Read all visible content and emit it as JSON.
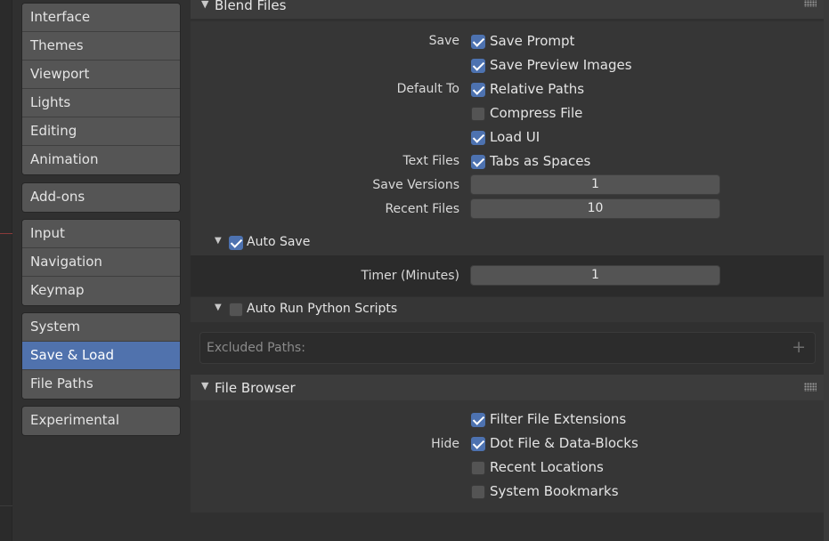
{
  "sidebar": {
    "groups": [
      {
        "items": [
          {
            "label": "Interface",
            "active": false
          },
          {
            "label": "Themes",
            "active": false
          },
          {
            "label": "Viewport",
            "active": false
          },
          {
            "label": "Lights",
            "active": false
          },
          {
            "label": "Editing",
            "active": false
          },
          {
            "label": "Animation",
            "active": false
          }
        ]
      },
      {
        "items": [
          {
            "label": "Add-ons",
            "active": false
          }
        ]
      },
      {
        "items": [
          {
            "label": "Input",
            "active": false
          },
          {
            "label": "Navigation",
            "active": false
          },
          {
            "label": "Keymap",
            "active": false
          }
        ]
      },
      {
        "items": [
          {
            "label": "System",
            "active": false
          },
          {
            "label": "Save & Load",
            "active": true
          },
          {
            "label": "File Paths",
            "active": false
          }
        ]
      },
      {
        "items": [
          {
            "label": "Experimental",
            "active": false
          }
        ]
      }
    ]
  },
  "blend_files": {
    "title": "Blend Files",
    "save_label": "Save",
    "save_prompt": {
      "label": "Save Prompt",
      "checked": true
    },
    "save_preview_images": {
      "label": "Save Preview Images",
      "checked": true
    },
    "default_to_label": "Default To",
    "relative_paths": {
      "label": "Relative Paths",
      "checked": true
    },
    "compress_file": {
      "label": "Compress File",
      "checked": false
    },
    "load_ui": {
      "label": "Load UI",
      "checked": true
    },
    "text_files_label": "Text Files",
    "tabs_as_spaces": {
      "label": "Tabs as Spaces",
      "checked": true
    },
    "save_versions": {
      "label": "Save Versions",
      "value": "1"
    },
    "recent_files": {
      "label": "Recent Files",
      "value": "10"
    },
    "auto_save": {
      "label": "Auto Save",
      "checked": true
    },
    "timer": {
      "label": "Timer (Minutes)",
      "value": "1"
    },
    "auto_run_python": {
      "label": "Auto Run Python Scripts",
      "checked": false
    },
    "excluded_paths": {
      "placeholder": "Excluded Paths:"
    }
  },
  "file_browser": {
    "title": "File Browser",
    "hide_label": "Hide",
    "filter_file_extensions": {
      "label": "Filter File Extensions",
      "checked": true
    },
    "dot_file": {
      "label": "Dot File & Data-Blocks",
      "checked": true
    },
    "recent_locations": {
      "label": "Recent Locations",
      "checked": false
    },
    "system_bookmarks": {
      "label": "System Bookmarks",
      "checked": false
    }
  },
  "colors": {
    "accent": "#4d72b0",
    "active_nav": "#5072ad",
    "background": "#303030",
    "panel": "#363636"
  }
}
